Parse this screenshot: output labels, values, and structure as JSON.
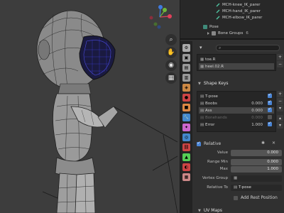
{
  "outliner": {
    "items": [
      {
        "label": "MCH-knee_IK_parer"
      },
      {
        "label": "MCH-hand_IK_parer"
      },
      {
        "label": "MCH-elbow_IK_parer"
      },
      {
        "label": "Pose"
      },
      {
        "label": "Bone Groups"
      }
    ],
    "bone_groups_count": "6"
  },
  "properties": {
    "search_placeholder": "",
    "vertex_groups": [
      {
        "name": "toe.R"
      },
      {
        "name": "heel.02.R",
        "selected": true
      }
    ],
    "shape_keys": {
      "header": "Shape Keys",
      "items": [
        {
          "name": "T-pose",
          "value": "",
          "checked": true
        },
        {
          "name": "Boobs",
          "value": "0.000",
          "checked": true
        },
        {
          "name": "Ass",
          "value": "0.000",
          "checked": true,
          "selected": true
        },
        {
          "name": "Bonehands",
          "value": "0.000",
          "checked": false,
          "dim": true
        },
        {
          "name": "Error",
          "value": "1.000",
          "checked": true
        }
      ]
    },
    "relative": {
      "label": "Relative",
      "checked": true
    },
    "fields": {
      "value": {
        "label": "Value",
        "value": "0.000"
      },
      "range_min": {
        "label": "Range Min",
        "value": "0.000"
      },
      "max": {
        "label": "Max",
        "value": "1.000"
      },
      "vertex_group": {
        "label": "Vertex Group",
        "value": ""
      },
      "relative_to": {
        "label": "Relative To",
        "value": "T-pose"
      }
    },
    "add_rest_position": {
      "label": "Add Rest Position"
    },
    "uv_maps": {
      "header": "UV Maps"
    }
  },
  "colors": {
    "accent": "#4a85d6",
    "viewport_bg": "#3d3d3d",
    "panel_bg": "#303030"
  }
}
